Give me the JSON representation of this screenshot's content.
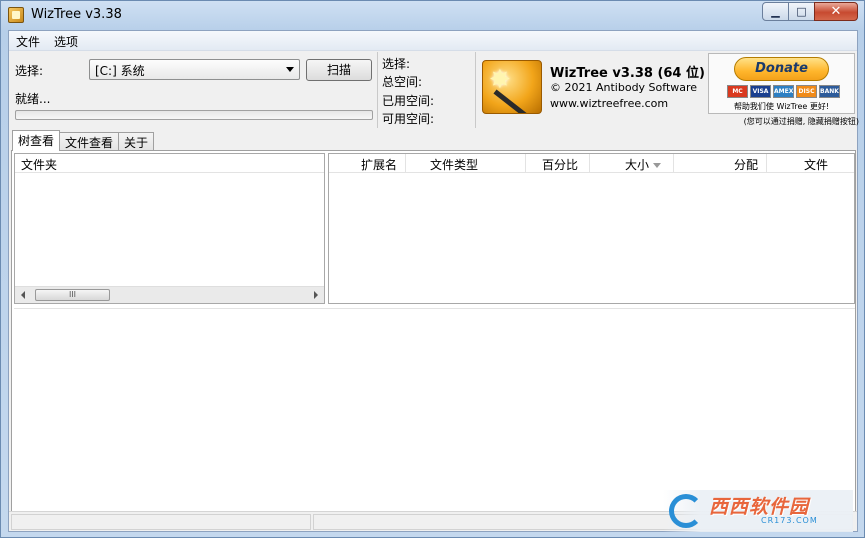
{
  "window": {
    "title": "WizTree v3.38"
  },
  "caption_buttons": {
    "minimize": "▁",
    "maximize": "□",
    "close": "✕"
  },
  "menu": {
    "items": [
      "文件",
      "选项"
    ]
  },
  "drive": {
    "select_label": "选择:",
    "selected": "[C:] 系统",
    "scan_button": "扫描",
    "status": "就绪..."
  },
  "info": {
    "selected": "选择:",
    "total": "总空间:",
    "used": "已用空间:",
    "free": "可用空间:"
  },
  "about": {
    "name": "WizTree v3.38 (64 位)",
    "copyright": "© 2021 Antibody Software",
    "url": "www.wiztreefree.com"
  },
  "donate": {
    "button": "Donate",
    "cards": [
      "MC",
      "VISA",
      "AMEX",
      "DISC",
      "BANK"
    ],
    "help": "帮助我们使 WizTree 更好!",
    "note": "(您可以通过捐赠, 隐藏捐赠按钮)"
  },
  "tabs": [
    {
      "label": "树查看",
      "active": true
    },
    {
      "label": "文件查看",
      "active": false
    },
    {
      "label": "关于",
      "active": false
    }
  ],
  "tree_pane": {
    "column": "文件夹",
    "scroll_thumb": "III"
  },
  "ext_pane": {
    "columns": [
      "扩展名",
      "文件类型",
      "百分比",
      "大小",
      "分配",
      "文件"
    ]
  },
  "watermark": {
    "brand": "西西软件园",
    "site": "CR173.COM"
  }
}
